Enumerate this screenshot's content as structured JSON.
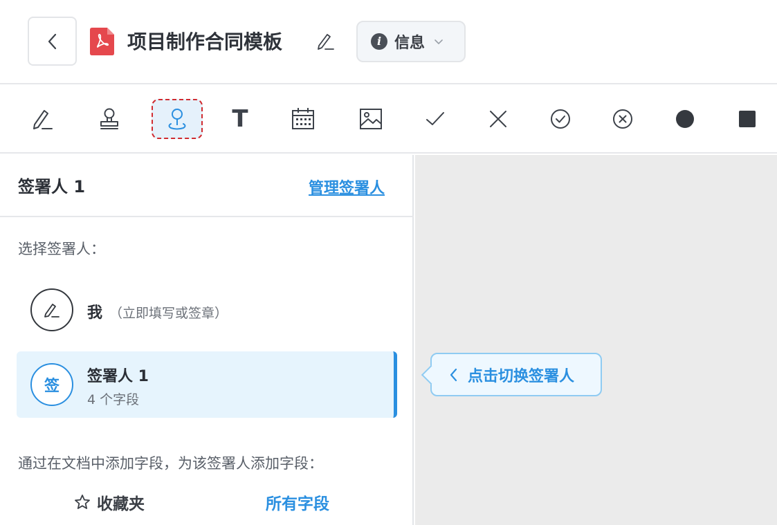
{
  "header": {
    "doc_title": "项目制作合同模板",
    "info_label": "信息",
    "info_icon_glyph": "i",
    "icons": [
      "chevron-left-icon",
      "pdf-file-icon",
      "pencil-icon",
      "info-circle-icon",
      "chevron-down-icon"
    ]
  },
  "toolbar": {
    "text_tool_glyph": "T",
    "tools": [
      "signature",
      "stamp",
      "signer-field",
      "text",
      "date",
      "image",
      "checkmark",
      "cross",
      "check-circle",
      "cross-circle",
      "filled-circle",
      "filled-square"
    ],
    "active_tool": "signer-field"
  },
  "panel": {
    "title": "签署人 1",
    "manage_link": "管理签署人",
    "select_label": "选择签署人：",
    "me": {
      "name": "我",
      "note": "（立即填写或签章）"
    },
    "signer": {
      "avatar_char": "签",
      "name": "签署人 1",
      "fields": "4 个字段"
    },
    "add_fields_label": "通过在文档中添加字段，为该签署人添加字段：",
    "tabs": {
      "favorites": "收藏夹",
      "all": "所有字段"
    }
  },
  "canvas": {
    "hint": "点击切换签署人"
  },
  "colors": {
    "accent": "#2a8fe0",
    "pdf_red": "#e5484d",
    "active_dash": "#d02b30",
    "selected_bg": "#e6f4fd",
    "canvas_bg": "#ebebeb"
  }
}
